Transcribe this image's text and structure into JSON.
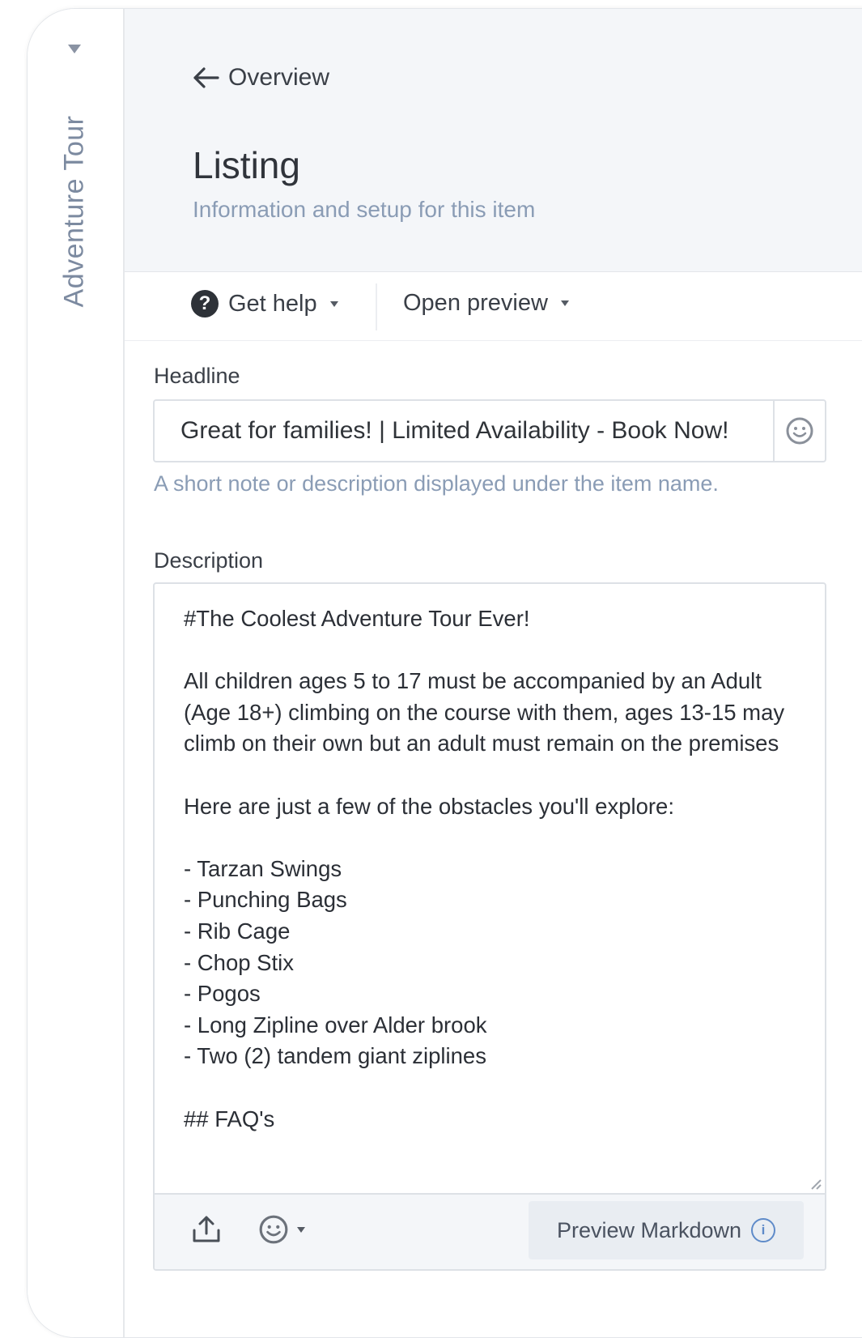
{
  "sidebar": {
    "title": "Adventure Tour"
  },
  "header": {
    "back_label": "Overview",
    "title": "Listing",
    "subtitle": "Information and setup for this item"
  },
  "toolbar": {
    "help_label": "Get help",
    "preview_label": "Open preview"
  },
  "form": {
    "headline": {
      "label": "Headline",
      "value": "Great for families! | Limited Availability - Book Now!",
      "helper": "A short note or description displayed under the item name."
    },
    "description": {
      "label": "Description",
      "value": "#The Coolest Adventure Tour Ever!\n\nAll children ages 5 to 17 must be accompanied by an Adult (Age 18+) climbing on the course with them, ages 13-15 may climb on their own but an adult must remain on the premises\n\nHere are just a few of the obstacles you'll explore:\n\n- Tarzan Swings\n- Punching Bags\n- Rib Cage\n- Chop Stix\n- Pogos\n- Long Zipline over Alder brook\n- Two (2) tandem giant ziplines\n\n## FAQ's",
      "preview_button": "Preview Markdown"
    }
  },
  "icons": {
    "back": "arrow-left-icon",
    "help": "question-circle-icon",
    "emoji": "emoji-icon",
    "upload": "upload-icon",
    "info": "info-icon"
  },
  "colors": {
    "header_bg": "#f4f6f9",
    "muted_text": "#8a9cb5",
    "accent": "#5f8bc9"
  }
}
